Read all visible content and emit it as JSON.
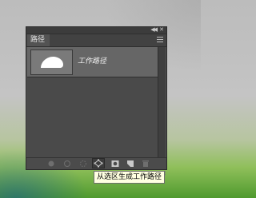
{
  "panel": {
    "tab_label": "路径",
    "header_icons": {
      "collapse": "double-chevron-icon",
      "close": "close-icon",
      "menu": "panel-menu-icon"
    },
    "paths": [
      {
        "name": "工作路径",
        "thumbnail": "cloud-shape-icon",
        "selected": true
      }
    ],
    "bottom_toolbar": [
      {
        "name": "fill-path-icon"
      },
      {
        "name": "stroke-path-icon"
      },
      {
        "name": "load-as-selection-icon"
      },
      {
        "name": "make-work-path-icon",
        "active": true
      },
      {
        "name": "add-mask-icon"
      },
      {
        "name": "new-path-icon"
      },
      {
        "name": "delete-path-icon"
      }
    ]
  },
  "tooltip": {
    "text": "从选区生成工作路径"
  }
}
